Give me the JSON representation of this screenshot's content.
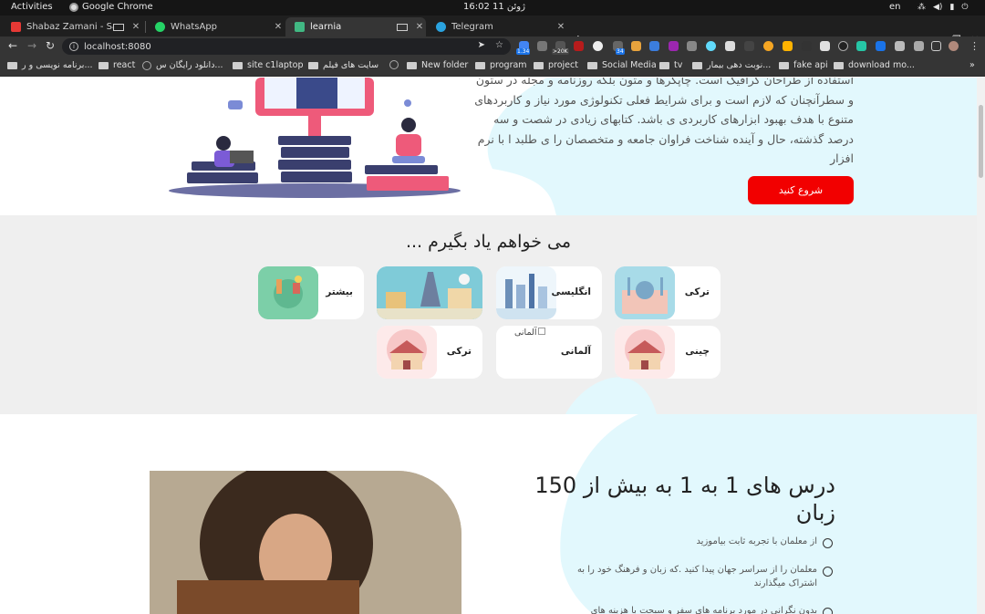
{
  "system": {
    "activities": "Activities",
    "app_name": "Google Chrome",
    "clock": "16:02 ژوئن 11",
    "lang": "en"
  },
  "tabs": [
    {
      "title": "Shabaz Zamani - Sarka",
      "color": "#e53935"
    },
    {
      "title": "WhatsApp",
      "color": "#25d366"
    },
    {
      "title": "learnia",
      "color": "#41b883"
    },
    {
      "title": "Telegram",
      "color": "#2aa3df"
    }
  ],
  "toolbar": {
    "url": "localhost:8080"
  },
  "extension_badges": [
    "1.34",
    ">20K",
    "34"
  ],
  "bookmarks": [
    "برنامه نویسی و ر...",
    "react",
    "دانلود رایگان س...",
    "site c1laptop",
    "سایت های فیلم",
    "New folder",
    "program",
    "project",
    "Social Media",
    "tv",
    "نوبت دهی بیمار...",
    "fake api",
    "download mo..."
  ],
  "hero": {
    "paragraph": "استفاده از طراحان گرافیک است. چاپگرها و متون بلکه روزنامه و مجله در ستون و سطرآنچنان که لازم است و برای شرایط فعلی تکنولوژی مورد نیاز و کاربردهای متنوع با هدف بهبود ابزارهای کاربردی ی باشد. کتابهای زیادی در شصت و سه درصد گذشته، حال و آینده شناخت فراوان جامعه و متخصصان را ی طلبد ا با نرم افزار",
    "cta_label": "شروع کنید"
  },
  "learn": {
    "title": "می خواهم یاد بگیرم ...",
    "cards": [
      {
        "label": "ترکی"
      },
      {
        "label": "انگلیسی"
      },
      {
        "label": ""
      },
      {
        "label": "بیشتر"
      },
      {
        "label": "چینی"
      },
      {
        "label": "آلمانی",
        "alt": "آلمانی"
      },
      {
        "label": "ترکی"
      }
    ]
  },
  "feature": {
    "title": "درس های 1 به 1 به بیش از 150 زبان",
    "items": [
      "از معلمان با تجربه ثابت بیاموزید",
      "معلمان را از سراسر جهان پیدا کنید .که زبان و فرهنگ خود را به اشتراک میگذارند",
      "بدون نگرانی در مورد برنامه های سفر و سبحت با هزینه های"
    ]
  }
}
